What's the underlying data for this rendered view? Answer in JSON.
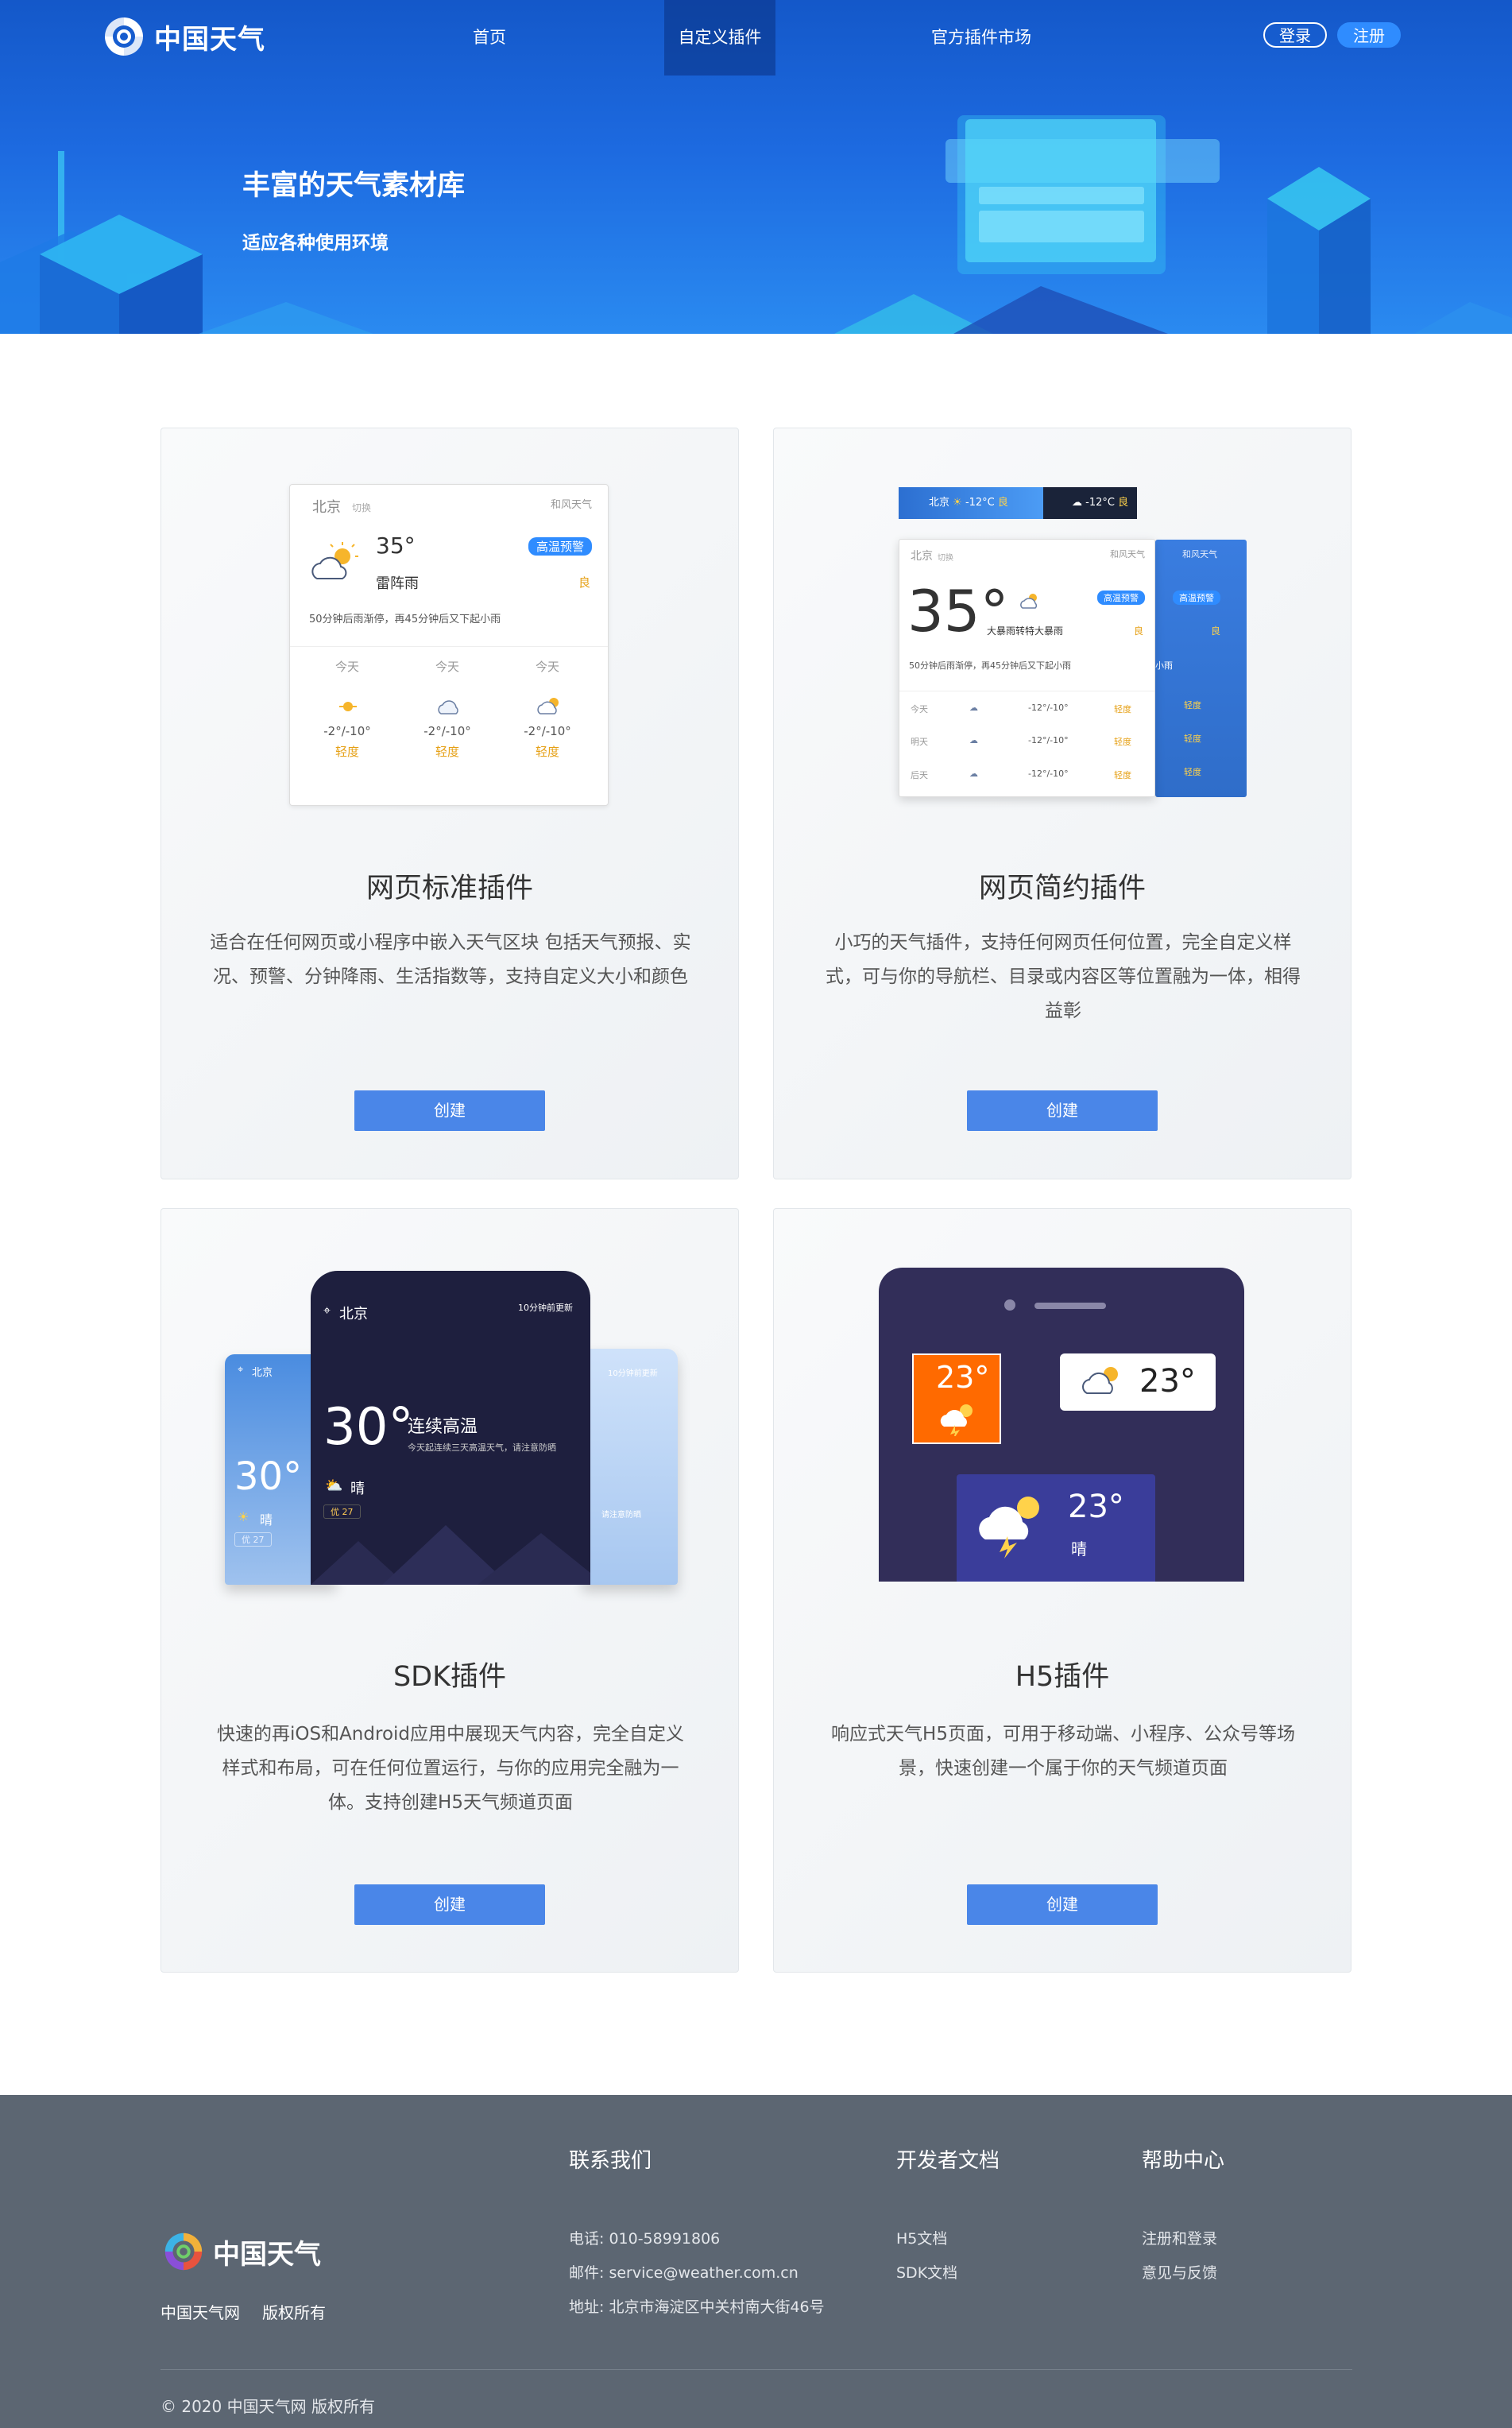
{
  "brand": {
    "name": "中国天气"
  },
  "nav": {
    "items": [
      {
        "label": "首页"
      },
      {
        "label": "自定义插件",
        "active": true
      },
      {
        "label": "官方插件市场"
      }
    ],
    "login": "登录",
    "register": "注册"
  },
  "hero": {
    "title": "丰富的天气素材库",
    "subtitle": "适应各种使用环境"
  },
  "colors": {
    "primary": "#4a86e8",
    "header": "#1458c9",
    "footer": "#5c6672",
    "warning": "#e6a117"
  },
  "cards": [
    {
      "title": "网页标准插件",
      "desc": "适合在任何网页或小程序中嵌入天气区块 包括天气预报、实况、预警、分钟降雨、生活指数等，支持自定义大小和颜色",
      "button": "创建",
      "mock": {
        "city": "北京",
        "switch": "切换",
        "brand": "和风天气",
        "temp": "35°",
        "cond": "雷阵雨",
        "alert": "高温预警",
        "aqi": "良",
        "rain": "50分钟后雨渐停，再45分钟后又下起小雨",
        "days": [
          {
            "day": "今天",
            "temp": "-2°/-10°",
            "level": "轻度",
            "icon": "sun-icon"
          },
          {
            "day": "今天",
            "temp": "-2°/-10°",
            "level": "轻度",
            "icon": "cloud-icon"
          },
          {
            "day": "今天",
            "temp": "-2°/-10°",
            "level": "轻度",
            "icon": "partly-cloudy-icon"
          }
        ]
      }
    },
    {
      "title": "网页简约插件",
      "desc": "小巧的天气插件，支持任何网页任何位置，完全自定义样式，可与你的导航栏、目录或内容区等位置融为一体，相得益彰",
      "button": "创建",
      "mock": {
        "bar_city": "北京",
        "bar_temp": "-12°C",
        "bar_aqi": "良",
        "bar_dark_temp": "-12°C",
        "city": "北京",
        "switch": "切换",
        "brand": "和风天气",
        "temp": "35°",
        "alert": "高温预警",
        "cond": "大暴雨转特大暴雨",
        "aqi": "良",
        "rain": "50分钟后雨渐停，再45分钟后又下起小雨",
        "back_brand": "和风天气",
        "back_alert": "高温预警",
        "back_aqi": "良",
        "back_rain": "小雨",
        "rows": [
          {
            "day": "今天",
            "temp": "-12°/-10°",
            "level": "轻度"
          },
          {
            "day": "明天",
            "temp": "-12°/-10°",
            "level": "轻度"
          },
          {
            "day": "后天",
            "temp": "-12°/-10°",
            "level": "轻度"
          }
        ]
      }
    },
    {
      "title": "SDK插件",
      "desc": "快速的再iOS和Android应用中展现天气内容，完全自定义样式和布局，可在任何位置运行，与你的应用完全融为一体。支持创建H5天气频道页面",
      "button": "创建",
      "mock": {
        "city": "北京",
        "updated": "10分钟前更新",
        "temp": "30°",
        "headline": "连续高温",
        "headline_sub": "今天起连续三天高温天气，请注意防晒",
        "cond": "晴",
        "aqi": "优 27",
        "left_city": "北京",
        "left_temp": "30°",
        "left_cond": "晴",
        "left_aqi": "优 27",
        "right_updated": "10分钟前更新",
        "right_note": "请注意防晒"
      }
    },
    {
      "title": "H5插件",
      "desc": "响应式天气H5页面，可用于移动端、小程序、公众号等场景，快速创建一个属于你的天气频道页面",
      "button": "创建",
      "mock": {
        "temp1": "23°",
        "temp2": "23°",
        "temp3": "23°",
        "cond3": "晴"
      }
    }
  ],
  "footer": {
    "brand": "中国天气",
    "copy_site": "中国天气网",
    "copy_rights": "版权所有",
    "contact": {
      "title": "联系我们",
      "phone": "电话: 010-58991806",
      "email": "邮件: service@weather.com.cn",
      "address": "地址: 北京市海淀区中关村南大街46号"
    },
    "docs": {
      "title": "开发者文档",
      "h5": "H5文档",
      "sdk": "SDK文档"
    },
    "help": {
      "title": "帮助中心",
      "login": "注册和登录",
      "feedback": "意见与反馈"
    },
    "bottom": "© 2020 中国天气网 版权所有"
  }
}
